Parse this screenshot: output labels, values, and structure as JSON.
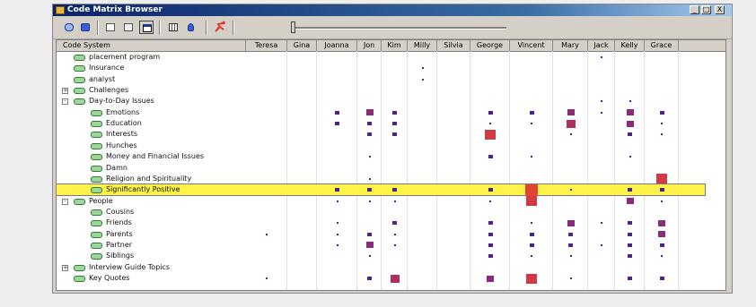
{
  "window": {
    "title": "Code Matrix Browser",
    "controls": [
      "_",
      "□",
      "X"
    ]
  },
  "toolbar": {
    "buttons": [
      {
        "name": "open-icon"
      },
      {
        "name": "camera-icon"
      },
      {
        "name": "copy-icon"
      },
      {
        "name": "paste-icon"
      },
      {
        "name": "window-icon"
      },
      {
        "name": "grid-icon"
      },
      {
        "name": "pin-icon"
      },
      {
        "name": "run-icon"
      }
    ],
    "slider_value": 0
  },
  "matrix": {
    "header": "Code System",
    "columns": [
      "Teresa",
      "Gina",
      "Joanna",
      "Jon",
      "Kim",
      "Milly",
      "Silvia",
      "George",
      "Vincent",
      "Mary",
      "Jack",
      "Kelly",
      "Grace"
    ],
    "rows": [
      {
        "label": "placement program",
        "depth": 0,
        "exp": "",
        "cells": [
          [
            10,
            1
          ]
        ]
      },
      {
        "label": "Insurance",
        "depth": 0,
        "exp": "",
        "cells": [
          [
            5,
            1
          ]
        ]
      },
      {
        "label": "analyst",
        "depth": 0,
        "exp": "",
        "cells": [
          [
            5,
            1
          ]
        ]
      },
      {
        "label": "Challenges",
        "depth": 0,
        "exp": "+",
        "cells": []
      },
      {
        "label": "Day-to-Day Issues",
        "depth": 0,
        "exp": "-",
        "cells": [
          [
            10,
            1
          ],
          [
            11,
            1
          ]
        ]
      },
      {
        "label": "Emotions",
        "depth": 1,
        "exp": "",
        "cells": [
          [
            2,
            2
          ],
          [
            3,
            3
          ],
          [
            4,
            2
          ],
          [
            7,
            2
          ],
          [
            8,
            2
          ],
          [
            9,
            3
          ],
          [
            10,
            1
          ],
          [
            11,
            3
          ],
          [
            12,
            2
          ]
        ]
      },
      {
        "label": "Education",
        "depth": 1,
        "exp": "",
        "cells": [
          [
            2,
            2
          ],
          [
            3,
            2
          ],
          [
            4,
            2
          ],
          [
            7,
            1
          ],
          [
            8,
            1
          ],
          [
            9,
            4
          ],
          [
            11,
            3
          ],
          [
            12,
            1
          ]
        ]
      },
      {
        "label": "Interests",
        "depth": 1,
        "exp": "",
        "cells": [
          [
            3,
            2
          ],
          [
            4,
            2
          ],
          [
            7,
            5
          ],
          [
            9,
            1
          ],
          [
            11,
            2
          ],
          [
            12,
            1
          ]
        ]
      },
      {
        "label": "Hunches",
        "depth": 1,
        "exp": "",
        "cells": []
      },
      {
        "label": "Money and Financial Issues",
        "depth": 1,
        "exp": "",
        "cells": [
          [
            3,
            1
          ],
          [
            7,
            2
          ],
          [
            8,
            1
          ],
          [
            11,
            1
          ]
        ]
      },
      {
        "label": "Damn",
        "depth": 1,
        "exp": "",
        "cells": []
      },
      {
        "label": "Religion and Spirituality",
        "depth": 1,
        "exp": "",
        "cells": [
          [
            3,
            1
          ],
          [
            12,
            5
          ]
        ]
      },
      {
        "label": "Significantly Positive",
        "depth": 1,
        "exp": "",
        "hl": true,
        "cells": [
          [
            2,
            2
          ],
          [
            3,
            2
          ],
          [
            4,
            2
          ],
          [
            7,
            2
          ],
          [
            8,
            6
          ],
          [
            9,
            1
          ],
          [
            11,
            2
          ],
          [
            12,
            2
          ]
        ]
      },
      {
        "label": "People",
        "depth": 0,
        "exp": "-",
        "cells": [
          [
            2,
            1
          ],
          [
            3,
            1
          ],
          [
            4,
            1
          ],
          [
            7,
            1
          ],
          [
            8,
            5
          ],
          [
            11,
            3
          ],
          [
            12,
            1
          ]
        ]
      },
      {
        "label": "Cousins",
        "depth": 1,
        "exp": "",
        "cells": []
      },
      {
        "label": "Friends",
        "depth": 1,
        "exp": "",
        "cells": [
          [
            2,
            1
          ],
          [
            4,
            2
          ],
          [
            7,
            2
          ],
          [
            8,
            1
          ],
          [
            9,
            3
          ],
          [
            10,
            1
          ],
          [
            11,
            2
          ],
          [
            12,
            3
          ]
        ]
      },
      {
        "label": "Parents",
        "depth": 1,
        "exp": "",
        "cells": [
          [
            0,
            1
          ],
          [
            2,
            1
          ],
          [
            3,
            2
          ],
          [
            4,
            1
          ],
          [
            7,
            2
          ],
          [
            8,
            2
          ],
          [
            9,
            2
          ],
          [
            11,
            2
          ],
          [
            12,
            3
          ]
        ]
      },
      {
        "label": "Partner",
        "depth": 1,
        "exp": "",
        "cells": [
          [
            2,
            1
          ],
          [
            3,
            3
          ],
          [
            4,
            1
          ],
          [
            7,
            2
          ],
          [
            8,
            2
          ],
          [
            9,
            2
          ],
          [
            10,
            1
          ],
          [
            11,
            2
          ],
          [
            12,
            2
          ]
        ]
      },
      {
        "label": "Siblings",
        "depth": 1,
        "exp": "",
        "cells": [
          [
            3,
            1
          ],
          [
            7,
            2
          ],
          [
            8,
            1
          ],
          [
            9,
            1
          ],
          [
            11,
            2
          ],
          [
            12,
            1
          ]
        ]
      },
      {
        "label": "Interview Guide Topics",
        "depth": 0,
        "exp": "+",
        "cells": []
      },
      {
        "label": "Key Quotes",
        "depth": 0,
        "exp": "",
        "cells": [
          [
            0,
            1
          ],
          [
            3,
            2
          ],
          [
            4,
            4
          ],
          [
            7,
            3
          ],
          [
            8,
            5
          ],
          [
            9,
            1
          ],
          [
            11,
            2
          ],
          [
            12,
            2
          ]
        ]
      }
    ]
  }
}
